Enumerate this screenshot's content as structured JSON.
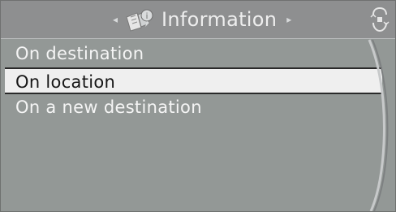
{
  "header": {
    "title": "Information",
    "icon": "info-book-icon",
    "left_arrow": "◂",
    "right_arrow": "▸"
  },
  "menu": {
    "items": [
      {
        "label": "On destination",
        "selected": false
      },
      {
        "label": "On location",
        "selected": true
      },
      {
        "label": "On a new destination",
        "selected": false
      }
    ]
  },
  "colors": {
    "background": "#939896",
    "header_background": "#8e8f90",
    "selected_background": "#efefef",
    "text": "#f5f5f5",
    "selected_text": "#161616"
  }
}
